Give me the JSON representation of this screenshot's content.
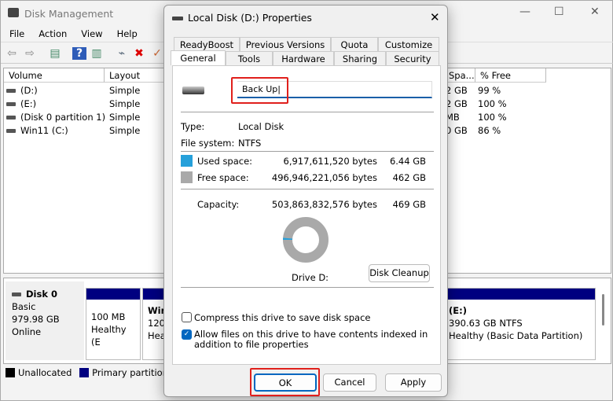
{
  "main": {
    "title": "Disk Management",
    "menu": [
      "File",
      "Action",
      "View",
      "Help"
    ],
    "columns": [
      "Volume",
      "Layout",
      "Spa...",
      "% Free"
    ],
    "rows": [
      {
        "volume": "(D:)",
        "layout": "Simple",
        "space": "2 GB",
        "free": "99 %"
      },
      {
        "volume": "(E:)",
        "layout": "Simple",
        "space": "2 GB",
        "free": "100 %"
      },
      {
        "volume": "(Disk 0 partition 1)",
        "layout": "Simple",
        "space": "MB",
        "free": "100 %"
      },
      {
        "volume": "Win11 (C:)",
        "layout": "Simple",
        "space": "0 GB",
        "free": "86 %"
      }
    ],
    "disk": {
      "name": "Disk 0",
      "type": "Basic",
      "size": "979.98 GB",
      "status": "Online"
    },
    "partitions": [
      {
        "size": "100 MB",
        "status": "Healthy (E"
      },
      {
        "name": "Win",
        "size": "120.",
        "status": "Hea"
      },
      {
        "name": "(E:)",
        "size": "390.63 GB NTFS",
        "status": "Healthy (Basic Data Partition)"
      }
    ],
    "legend": [
      "Unallocated",
      "Primary partition"
    ]
  },
  "dialog": {
    "title": "Local Disk (D:) Properties",
    "tabs_row1": [
      "ReadyBoost",
      "Previous Versions",
      "Quota",
      "Customize"
    ],
    "tabs_row2": [
      "General",
      "Tools",
      "Hardware",
      "Sharing",
      "Security"
    ],
    "active_tab": "General",
    "name_value": "Back Up",
    "type_label": "Type:",
    "type_value": "Local Disk",
    "fs_label": "File system:",
    "fs_value": "NTFS",
    "used_label": "Used space:",
    "used_bytes": "6,917,611,520 bytes",
    "used_gb": "6.44 GB",
    "free_label": "Free space:",
    "free_bytes": "496,946,221,056 bytes",
    "free_gb": "462 GB",
    "cap_label": "Capacity:",
    "cap_bytes": "503,863,832,576 bytes",
    "cap_gb": "469 GB",
    "used_fraction": 0.0137,
    "drive_label": "Drive D:",
    "cleanup": "Disk Cleanup",
    "compress": "Compress this drive to save disk space",
    "compress_checked": false,
    "index": "Allow files on this drive to have contents indexed in addition to file properties",
    "index_checked": true,
    "ok": "OK",
    "cancel": "Cancel",
    "apply": "Apply",
    "colors": {
      "used": "#26a0da",
      "free": "#a9a9a9",
      "highlight": "#e0201c",
      "primary": "#000080"
    }
  }
}
